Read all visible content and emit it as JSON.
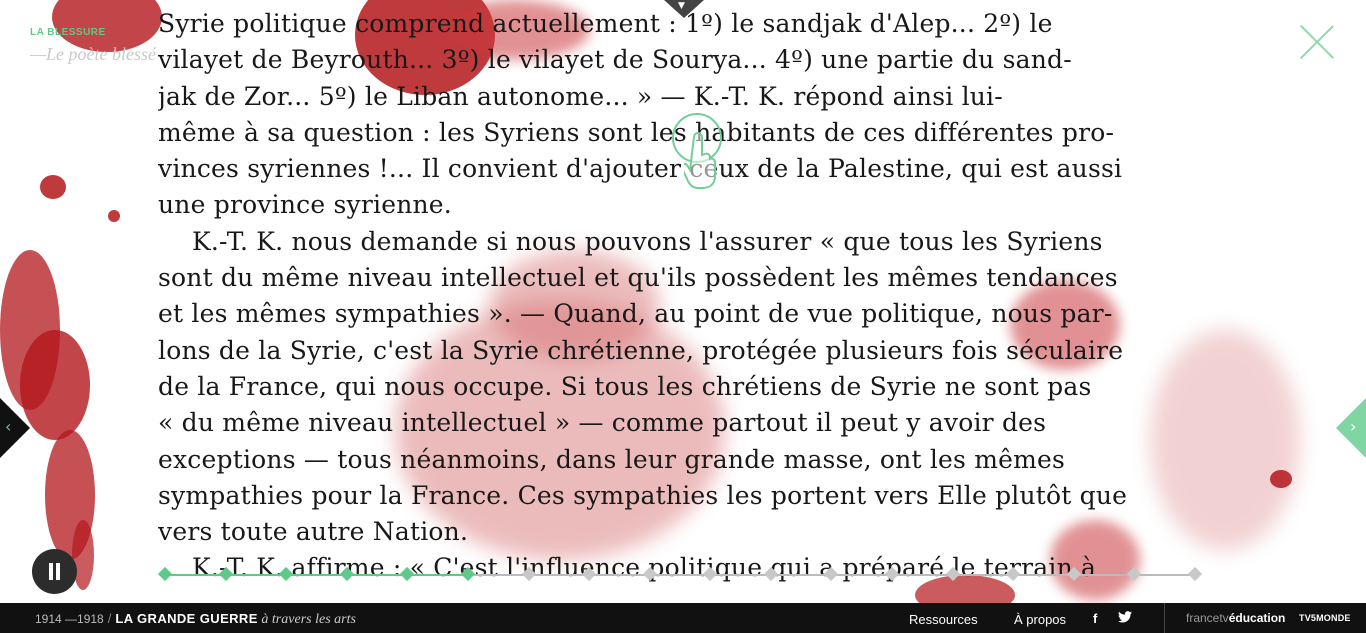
{
  "header": {
    "kicker": "LA BLESSURE",
    "subtitle": "—Le poète blessé",
    "top_tab_icon": "chevron-down-icon"
  },
  "document": {
    "lines": [
      "Syrie politique comprend actuellement : 1º) le sandjak d'Alep... 2º) le",
      "vilayet de Beyrouth... 3º) le vilayet de Sourya... 4º) une partie du sand-",
      "jak de Zor... 5º) le Liban autonome... » — K.-T. K. répond ainsi lui-",
      "même à sa question : les Syriens sont les habitants de ces différentes pro-",
      "vinces syriennes !... Il convient d'ajouter ceux de la Palestine, qui est aussi",
      "une province syrienne.",
      "K.-T. K. nous demande si nous pouvons l'assurer « que tous les Syriens",
      "sont du même niveau intellectuel et qu'ils possèdent les mêmes tendances",
      "et les mêmes sympathies ». — Quand, au point de vue politique, nous par-",
      "lons de la Syrie, c'est la Syrie chrétienne, protégée plusieurs fois séculaire",
      "de la France, qui nous occupe. Si tous les chrétiens de Syrie ne sont pas",
      "« du même niveau intellectuel » — comme partout il peut y avoir des",
      "exceptions — tous néanmoins, dans leur grande masse, ont les mêmes",
      "sympathies pour la France. Ces sympathies les portent vers Elle plutôt que",
      "vers toute autre Nation.",
      "K.-T. K. affirme : « C'est l'influence politique qui a préparé le terrain à"
    ]
  },
  "controls": {
    "close_icon": "close-icon",
    "prev_icon": "chevron-left-icon",
    "prev_glyph": "‹",
    "next_icon": "chevron-right-icon",
    "next_glyph": "›",
    "pause_icon": "pause-icon",
    "hand_icon": "hand-pointer-icon"
  },
  "timeline": {
    "markers": 18,
    "progress": 0.3
  },
  "footer": {
    "years": "1914 —1918",
    "title": "LA GRANDE GUERRE",
    "subtitle": "à travers les arts",
    "links": [
      "Ressources",
      "À propos"
    ],
    "facebook": "f",
    "twitter_icon": "twitter-icon",
    "partner1_a": "francetv",
    "partner1_b": "éducation",
    "partner2": "TV5MONDE"
  },
  "colors": {
    "accent": "#5fc98a",
    "blood": "#b3171b",
    "footer_bg": "#111111"
  }
}
